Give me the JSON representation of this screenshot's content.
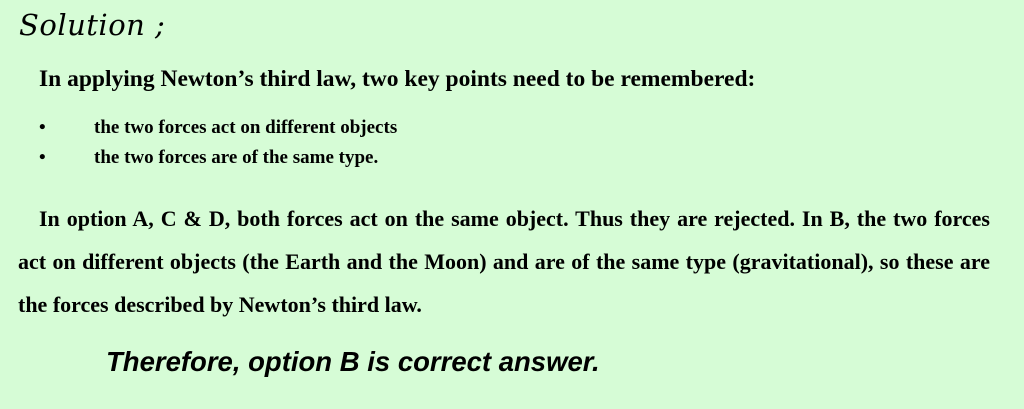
{
  "heading": "Solution ;",
  "intro": "In applying Newton’s third law, two key points need to be remembered:",
  "points": [
    {
      "bullet": "•",
      "text": "the two forces act on different objects"
    },
    {
      "bullet": "•",
      "text": "the two forces are of the same type."
    }
  ],
  "paragraph": "In option A, C & D, both forces act on the same object. Thus they are rejected. In B, the two forces act on different objects (the Earth and the Moon) and are of the same type (gravitational), so these are the forces described by Newton’s third law.",
  "conclusion": "Therefore, option B is correct answer.",
  "colors": {
    "background": "#d6fcd6",
    "text": "#000000"
  }
}
